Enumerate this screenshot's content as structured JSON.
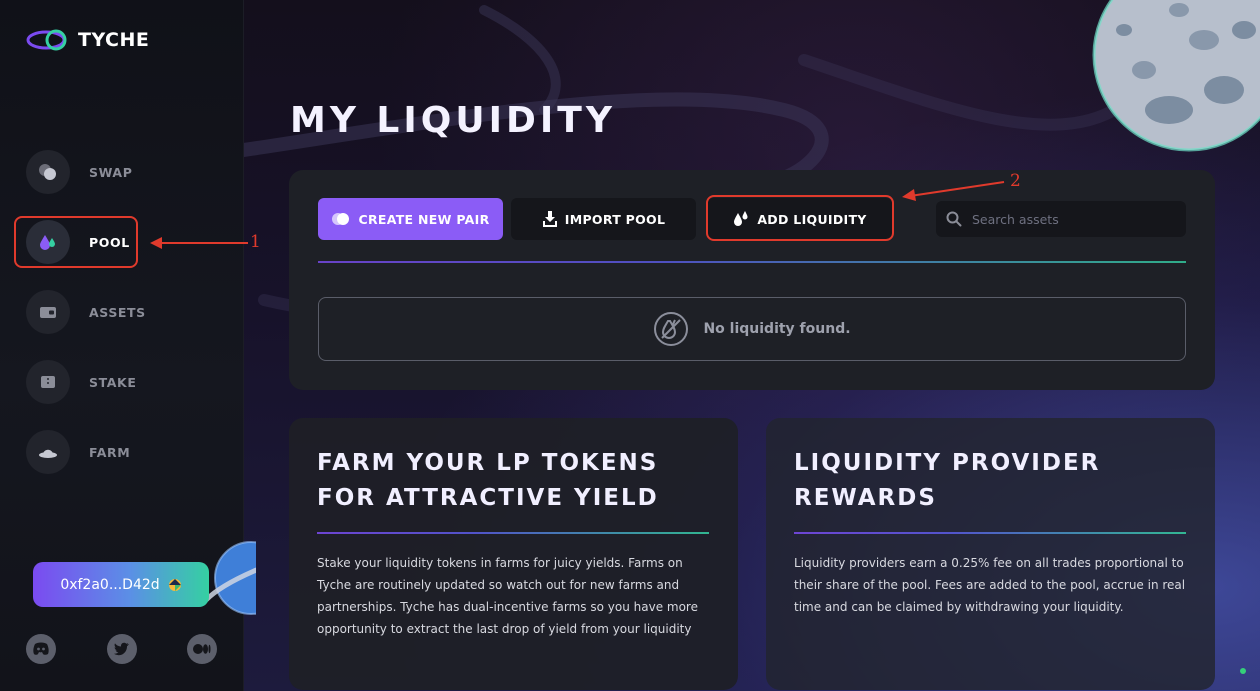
{
  "app": {
    "name": "TYCHE"
  },
  "sidebar": {
    "items": [
      {
        "label": "SWAP",
        "icon": "swap-icon"
      },
      {
        "label": "POOL",
        "icon": "drops-icon",
        "active": true
      },
      {
        "label": "ASSETS",
        "icon": "wallet-icon"
      },
      {
        "label": "STAKE",
        "icon": "ticket-icon"
      },
      {
        "label": "FARM",
        "icon": "farmer-hat-icon"
      }
    ],
    "wallet_address": "0xf2a0...D42d",
    "social": [
      "discord-icon",
      "twitter-icon",
      "medium-icon"
    ]
  },
  "main": {
    "title": "MY LIQUIDITY",
    "actions": {
      "create_pair": "CREATE NEW PAIR",
      "import_pool": "IMPORT POOL",
      "add_liquidity": "ADD LIQUIDITY"
    },
    "search": {
      "placeholder": "Search assets",
      "value": ""
    },
    "empty_message": "No liquidity found.",
    "cards": [
      {
        "title_line1": "FARM YOUR LP TOKENS",
        "title_line2": "FOR ATTRACTIVE YIELD",
        "body": "Stake your liquidity tokens in farms for juicy yields. Farms on Tyche are routinely updated so watch out for new farms and partnerships. Tyche has dual-incentive farms so you have more opportunity to extract the last drop of yield from your liquidity"
      },
      {
        "title_line1": "LIQUIDITY PROVIDER",
        "title_line2": "REWARDS",
        "body": "Liquidity providers earn a 0.25% fee on all trades proportional to their share of the pool. Fees are added to the pool, accrue in real time and can be claimed by withdrawing your liquidity."
      }
    ]
  },
  "annotations": {
    "one": "1",
    "two": "2"
  },
  "colors": {
    "accent": "#8b5cf6",
    "highlight": "#e03a2c",
    "gradient_start": "#7b4bf0",
    "gradient_end": "#35d0a2"
  }
}
